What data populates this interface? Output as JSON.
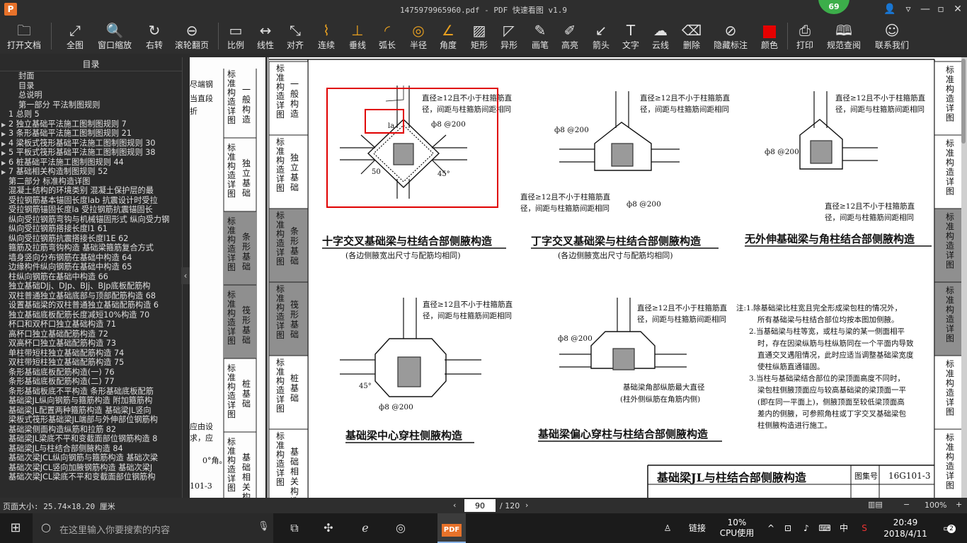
{
  "window": {
    "title": "1475979965960.pdf - PDF 快速看图 v1.9",
    "badge": "69",
    "app_logo": "P"
  },
  "toolbar": {
    "buttons": [
      {
        "label": "打开文档",
        "icon": "folder-icon"
      },
      {
        "label": "全图",
        "icon": "fullscreen-icon"
      },
      {
        "label": "窗口缩放",
        "icon": "zoom-icon"
      },
      {
        "label": "右转",
        "icon": "rotate-right-icon"
      },
      {
        "label": "滚轮翻页",
        "icon": "mouse-icon"
      },
      {
        "label": "比例",
        "icon": "scale-icon"
      },
      {
        "label": "线性",
        "icon": "linear-measure-icon"
      },
      {
        "label": "对齐",
        "icon": "align-measure-icon"
      },
      {
        "label": "连续",
        "icon": "continuous-measure-icon"
      },
      {
        "label": "垂线",
        "icon": "perpendicular-icon"
      },
      {
        "label": "弧长",
        "icon": "arc-length-icon"
      },
      {
        "label": "半径",
        "icon": "radius-icon"
      },
      {
        "label": "角度",
        "icon": "angle-icon"
      },
      {
        "label": "矩形",
        "icon": "rectangle-icon"
      },
      {
        "label": "异形",
        "icon": "polygon-icon"
      },
      {
        "label": "画笔",
        "icon": "pen-icon"
      },
      {
        "label": "高亮",
        "icon": "highlight-icon"
      },
      {
        "label": "箭头",
        "icon": "arrow-icon"
      },
      {
        "label": "文字",
        "icon": "text-icon"
      },
      {
        "label": "云线",
        "icon": "cloud-icon"
      },
      {
        "label": "删除",
        "icon": "eraser-icon"
      },
      {
        "label": "隐藏标注",
        "icon": "hide-eye-icon"
      },
      {
        "label": "颜色",
        "icon": "color-swatch-icon",
        "color": "#e60000"
      },
      {
        "label": "打印",
        "icon": "printer-icon"
      },
      {
        "label": "规范查阅",
        "icon": "book-icon"
      },
      {
        "label": "联系我们",
        "icon": "contact-icon"
      }
    ]
  },
  "sidebar": {
    "title": "目录",
    "items": [
      {
        "label": "封面",
        "arrow": ""
      },
      {
        "label": "目录",
        "arrow": ""
      },
      {
        "label": "总说明",
        "arrow": ""
      },
      {
        "label": "第一部分 平法制图规则",
        "arrow": ""
      },
      {
        "label": "1 总则 5",
        "arrow": ""
      },
      {
        "label": "2 独立基础平法施工图制图规则 7",
        "arrow": "▶"
      },
      {
        "label": "3 条形基础平法施工图制图规则 21",
        "arrow": "▶"
      },
      {
        "label": "4 梁板式筏形基础平法施工图制图规则 30",
        "arrow": "▶"
      },
      {
        "label": "5 平板式筏形基础平法施工图制图规则 38",
        "arrow": "▶"
      },
      {
        "label": "6 桩基础平法施工图制图规则 44",
        "arrow": "▶"
      },
      {
        "label": "7 基础相关构造制图规则 52",
        "arrow": "▶"
      },
      {
        "label": "第二部分 标准构造详图",
        "arrow": ""
      },
      {
        "label": "混凝土结构的环境类别 混凝土保护层的最",
        "arrow": ""
      },
      {
        "label": "受拉钢筋基本锚固长度lab 抗震设计时受拉",
        "arrow": ""
      },
      {
        "label": "受拉钢筋锚固长度la 受拉钢筋抗震锚固长",
        "arrow": ""
      },
      {
        "label": "纵向受拉钢筋弯钩与机械锚固形式 纵向受力钢",
        "arrow": ""
      },
      {
        "label": "纵向受拉钢筋搭接长度l1 61",
        "arrow": ""
      },
      {
        "label": "纵向受拉钢筋抗震搭接长度l1E 62",
        "arrow": ""
      },
      {
        "label": "箍筋及拉筋弯钩构造 基础梁箍筋复合方式",
        "arrow": ""
      },
      {
        "label": "墙身竖向分布钢筋在基础中构造 64",
        "arrow": ""
      },
      {
        "label": "边缘构件纵向钢筋在基础中构造 65",
        "arrow": ""
      },
      {
        "label": "柱纵向钢筋在基础中构造 66",
        "arrow": ""
      },
      {
        "label": "独立基础DJj、DJp、BJj、BJp底板配筋构",
        "arrow": ""
      },
      {
        "label": "双柱普通独立基础底部与顶部配筋构造 68",
        "arrow": ""
      },
      {
        "label": "设置基础梁的双柱普通独立基础配筋构造 6",
        "arrow": ""
      },
      {
        "label": "独立基础底板配筋长度减短10%构造 70",
        "arrow": ""
      },
      {
        "label": "杯口和双杯口独立基础构造 71",
        "arrow": ""
      },
      {
        "label": "高杯口独立基础配筋构造 72",
        "arrow": ""
      },
      {
        "label": "双高杯口独立基础配筋构造 73",
        "arrow": ""
      },
      {
        "label": "单柱带短柱独立基础配筋构造 74",
        "arrow": ""
      },
      {
        "label": "双柱带短柱独立基础配筋构造 75",
        "arrow": ""
      },
      {
        "label": "条形基础底板配筋构造(一) 76",
        "arrow": ""
      },
      {
        "label": "条形基础底板配筋构造(二) 77",
        "arrow": ""
      },
      {
        "label": "条形基础板底不平构造 条形基础底板配筋",
        "arrow": ""
      },
      {
        "label": "基础梁JL纵向钢筋与箍筋构造 附加箍筋构",
        "arrow": ""
      },
      {
        "label": "基础梁JL配置两种箍筋构造 基础梁JL竖向",
        "arrow": ""
      },
      {
        "label": "梁板式筏形基础梁JL端部与外伸部位钢筋构",
        "arrow": ""
      },
      {
        "label": "基础梁侧面构造纵筋和拉筋 82",
        "arrow": ""
      },
      {
        "label": "基础梁JL梁底不平和变截面部位钢筋构造 8",
        "arrow": ""
      },
      {
        "label": "基础梁JL与柱结合部侧腋构造 84",
        "arrow": ""
      },
      {
        "label": "基础次梁JCL纵向钢筋与箍筋构造 基础次梁",
        "arrow": ""
      },
      {
        "label": "基础次梁JCL竖向加腋钢筋构造 基础次梁J",
        "arrow": ""
      },
      {
        "label": "基础次梁JCL梁底不平和变截面部位钢筋构",
        "arrow": ""
      }
    ]
  },
  "status": {
    "page_size": "页面大小: 25.74×18.20 厘米",
    "current_page": "90",
    "total_pages": "/ 120",
    "zoom": "100%"
  },
  "drawing": {
    "side_tabs_left": [
      {
        "col1": "标准构造详图",
        "col2": "一般构造"
      },
      {
        "col1": "标准构造详图",
        "col2": "独立基础"
      },
      {
        "col1": "标准构造详图",
        "col2": "条形基础"
      },
      {
        "col1": "标准构造详图",
        "col2": "筏形基础"
      },
      {
        "col1": "标准构造详图",
        "col2": "桩基础"
      },
      {
        "col1": "标准构造详图",
        "col2": "基础相关构造"
      }
    ],
    "side_tabs_right": [
      "标准构造详图",
      "标准构造详图",
      "标准构造详图",
      "标准构造详图",
      "标准构造详图",
      "标准构造详图"
    ],
    "prev_page_snippets": [
      "尽端钢",
      "当直段",
      "折",
      "应由设",
      "求，应",
      "0°角。",
      "101-3"
    ],
    "note_dia": "直径≥12且不小于柱箍筋直",
    "note_spacing": "径，间距与柱箍筋间距相同",
    "stirrup": "ф8 @200",
    "dim_50": "50",
    "angle_45": "45°",
    "lap_la": "la",
    "fig1_title": "十字交叉基础梁与柱结合部侧腋构造",
    "fig1_sub": "(各边侧腋宽出尺寸与配筋均相同)",
    "fig2_title": "丁字交叉基础梁与柱结合部侧腋构造",
    "fig2_sub": "(各边侧腋宽出尺寸与配筋均相同)",
    "fig3_title": "无外伸基础梁与角柱结合部侧腋构造",
    "fig4_title": "基础梁中心穿柱侧腋构造",
    "fig5_title": "基础梁偏心穿柱与柱结合部侧腋构造",
    "fig5_note1": "基础梁角部纵筋最大直径",
    "fig5_note2": "(柱外侧纵筋在角筋内侧)",
    "notes": [
      "注:1.除基础梁比柱宽且完全形成梁包柱的情况外，",
      "所有基础梁与柱结合部位均按本图加侧腋。",
      "2.当基础梁与柱等宽，或柱与梁的某一侧面相平",
      "时，存在因梁纵筋与柱纵筋同在一个平面内导致",
      "直通交叉遇阻情况，此时应适当调整基础梁宽度",
      "使柱纵筋直通锚固。",
      "3.当柱与基础梁结合部位的梁顶面高度不同时，",
      "梁包柱侧腋顶面应与较高基础梁的梁顶面一平",
      "(即在同一平面上)，侧腋顶面至较低梁顶面高",
      "差内的侧腋，可参照角柱或丁字交叉基础梁包",
      "柱侧腋构造进行施工。"
    ],
    "title_block": "基础梁JL与柱结合部侧腋构造",
    "atlas_label": "图集号",
    "atlas_no": "16G101-3",
    "annotation_color": "#e00000"
  },
  "taskbar": {
    "search_placeholder": "在这里输入你要搜索的内容",
    "cpu_percent": "10%",
    "cpu_label": "CPU使用",
    "link": "链接",
    "ime": "中",
    "time": "20:49",
    "date": "2018/4/11",
    "notif_count": "2"
  }
}
